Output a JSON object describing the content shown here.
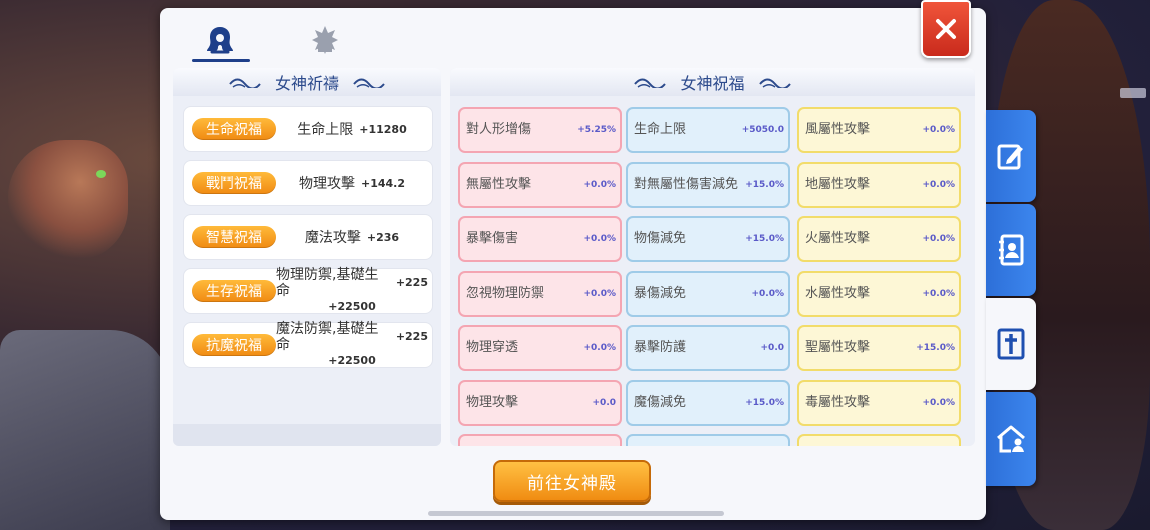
{
  "tabs": [
    {
      "icon": "goddess-icon",
      "active": true
    },
    {
      "icon": "flower-emblem-icon",
      "active": false
    }
  ],
  "left_section": {
    "title": "女神祈禱",
    "rows": [
      {
        "badge": "生命祝福",
        "stat": "生命上限",
        "value": "+11280"
      },
      {
        "badge": "戰鬥祝福",
        "stat": "物理攻擊",
        "value": "+144.2"
      },
      {
        "badge": "智慧祝福",
        "stat": "魔法攻擊",
        "value": "+236"
      },
      {
        "badge": "生存祝福",
        "stat": "物理防禦,基礎生命",
        "value": "+225",
        "value2": "+22500"
      },
      {
        "badge": "抗魔祝福",
        "stat": "魔法防禦,基礎生命",
        "value": "+225",
        "value2": "+22500"
      }
    ]
  },
  "right_section": {
    "title": "女神祝福",
    "columns": [
      {
        "color": "red",
        "cells": [
          {
            "name": "對人形增傷",
            "value": "+5.25%"
          },
          {
            "name": "無屬性攻擊",
            "value": "+0.0%"
          },
          {
            "name": "暴擊傷害",
            "value": "+0.0%"
          },
          {
            "name": "忽視物理防禦",
            "value": "+0.0%"
          },
          {
            "name": "物理穿透",
            "value": "+0.0%"
          },
          {
            "name": "物理攻擊",
            "value": "+0.0"
          }
        ]
      },
      {
        "color": "blue",
        "cells": [
          {
            "name": "生命上限",
            "value": "+5050.0"
          },
          {
            "name": "對無屬性傷害減免",
            "value": "+15.0%"
          },
          {
            "name": "物傷減免",
            "value": "+15.0%"
          },
          {
            "name": "暴傷減免",
            "value": "+0.0%"
          },
          {
            "name": "暴擊防護",
            "value": "+0.0"
          },
          {
            "name": "魔傷減免",
            "value": "+15.0%"
          }
        ]
      },
      {
        "color": "yellow",
        "cells": [
          {
            "name": "風屬性攻擊",
            "value": "+0.0%"
          },
          {
            "name": "地屬性攻擊",
            "value": "+0.0%"
          },
          {
            "name": "火屬性攻擊",
            "value": "+0.0%"
          },
          {
            "name": "水屬性攻擊",
            "value": "+0.0%"
          },
          {
            "name": "聖屬性攻擊",
            "value": "+15.0%"
          },
          {
            "name": "毒屬性攻擊",
            "value": "+0.0%"
          }
        ]
      }
    ]
  },
  "go_button": {
    "label": "前往女神殿"
  },
  "side_tabs": [
    {
      "icon": "edit-note-icon",
      "active": false
    },
    {
      "icon": "contact-book-icon",
      "active": false
    },
    {
      "icon": "holy-cross-icon",
      "active": true
    },
    {
      "icon": "guild-house-icon",
      "active": false
    }
  ],
  "colors": {
    "accent_orange": "#f5a020",
    "title_blue": "#2c4a8c",
    "side_tab_blue": "#3c86ee",
    "close_red": "#e0402a"
  }
}
